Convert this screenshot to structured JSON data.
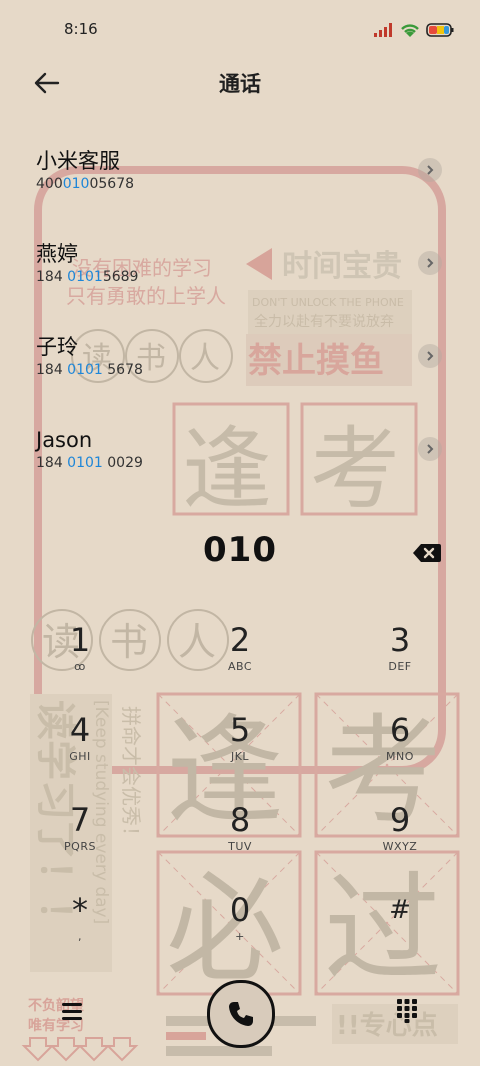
{
  "status_bar": {
    "time": "8:16"
  },
  "header": {
    "title": "通话"
  },
  "contacts": [
    {
      "name": "小米客服",
      "num_pre": "400",
      "num_hl": "010",
      "num_post": "05678"
    },
    {
      "name": "燕婷",
      "num_pre": "184 ",
      "num_hl": "0101",
      "num_post": "5689"
    },
    {
      "name": "子玲",
      "num_pre": "184 ",
      "num_hl": "0101",
      "num_post": " 5678"
    },
    {
      "name": "Jason",
      "num_pre": "184 ",
      "num_hl": "0101",
      "num_post": " 0029"
    }
  ],
  "dialer": {
    "dialed": "010"
  },
  "keys": [
    {
      "digit": "1",
      "letters": "ꝏ"
    },
    {
      "digit": "2",
      "letters": "ABC"
    },
    {
      "digit": "3",
      "letters": "DEF"
    },
    {
      "digit": "4",
      "letters": "GHI"
    },
    {
      "digit": "5",
      "letters": "JKL"
    },
    {
      "digit": "6",
      "letters": "MNO"
    },
    {
      "digit": "7",
      "letters": "PQRS"
    },
    {
      "digit": "8",
      "letters": "TUV"
    },
    {
      "digit": "9",
      "letters": "WXYZ"
    },
    {
      "digit": "*",
      "letters": ","
    },
    {
      "digit": "0",
      "letters": "+"
    },
    {
      "digit": "#",
      "letters": ""
    }
  ],
  "wallpaper": {
    "line1": "没有困难的学习",
    "line2": "只有勇敢的上学人",
    "sign1": "时间宝贵",
    "sign2": "DON'T UNLOCK THE PHONE",
    "sign3": "全力以赴有不要说放弃",
    "sign4": "禁止摸鱼",
    "circles": [
      "读",
      "书",
      "人"
    ],
    "big1": "逢",
    "big2": "考",
    "big3": "必",
    "big4": "过",
    "vert1": "拼命才会优秀！",
    "vert2": "[Keep studying every day]",
    "vert3": "读学习了！！",
    "foot1": "不负韶望",
    "foot2": "唯有学习",
    "foot3": "!!专心点"
  },
  "colors": {
    "accent": "#1e86d8",
    "bg": "#e6d9c8"
  }
}
